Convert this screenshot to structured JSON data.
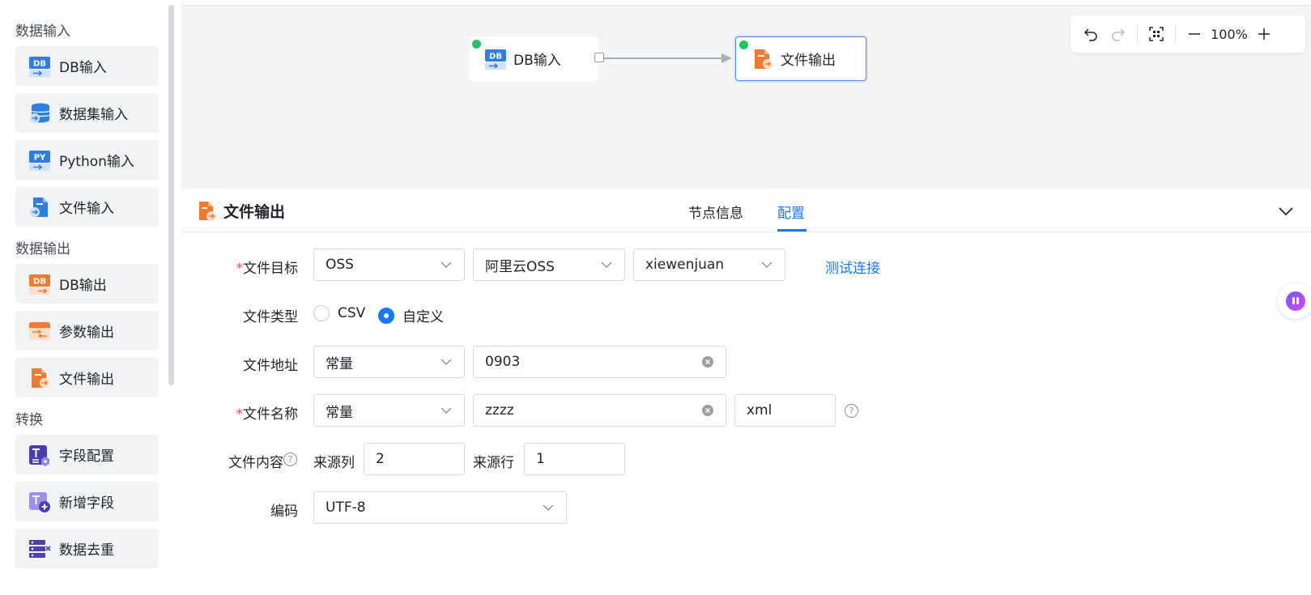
{
  "sidebar": {
    "sections": [
      {
        "title": "数据输入",
        "items": [
          {
            "label": "DB输入",
            "icon": "db-input-icon"
          },
          {
            "label": "数据集输入",
            "icon": "dataset-input-icon"
          },
          {
            "label": "Python输入",
            "icon": "python-input-icon"
          },
          {
            "label": "文件输入",
            "icon": "file-input-icon"
          }
        ]
      },
      {
        "title": "数据输出",
        "items": [
          {
            "label": "DB输出",
            "icon": "db-output-icon"
          },
          {
            "label": "参数输出",
            "icon": "param-output-icon"
          },
          {
            "label": "文件输出",
            "icon": "file-output-icon"
          }
        ]
      },
      {
        "title": "转换",
        "items": [
          {
            "label": "字段配置",
            "icon": "field-config-icon"
          },
          {
            "label": "新增字段",
            "icon": "add-field-icon"
          },
          {
            "label": "数据去重",
            "icon": "dedupe-icon"
          }
        ]
      }
    ]
  },
  "canvas": {
    "nodes": [
      {
        "label": "DB输入",
        "status": "green"
      },
      {
        "label": "文件输出",
        "status": "green"
      }
    ],
    "zoom": "100%"
  },
  "panel": {
    "title": "文件输出",
    "tabs": [
      {
        "label": "节点信息"
      },
      {
        "label": "配置",
        "active": true
      }
    ],
    "form": {
      "file_target": {
        "label": "文件目标",
        "required": true,
        "storage": "OSS",
        "provider": "阿里云OSS",
        "account": "xiewenjuan",
        "test_link": "测试连接"
      },
      "file_type": {
        "label": "文件类型",
        "options": [
          "CSV",
          "自定义"
        ],
        "selected": "自定义"
      },
      "file_path": {
        "label": "文件地址",
        "mode": "常量",
        "value": "0903"
      },
      "file_name": {
        "label": "文件名称",
        "required": true,
        "mode": "常量",
        "value": "zzzz",
        "ext": "xml"
      },
      "file_content": {
        "label": "文件内容",
        "source_col_label": "来源列",
        "source_col": "2",
        "source_row_label": "来源行",
        "source_row": "1"
      },
      "encoding": {
        "label": "编码",
        "value": "UTF-8"
      }
    }
  },
  "colors": {
    "accent": "#1677ff",
    "required": "#f53f3f",
    "status_ok": "#22c55e"
  }
}
